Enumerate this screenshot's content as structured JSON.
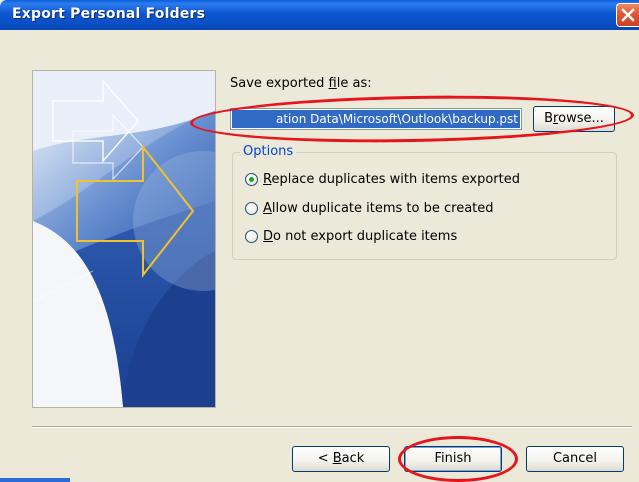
{
  "window": {
    "title": "Export Personal Folders",
    "accent": "#0a5fd8"
  },
  "save": {
    "label_prefix": "Save exported ",
    "label_underlined": "f",
    "label_suffix": "ile as:",
    "path_value": "ation Data\\Microsoft\\Outlook\\backup.pst",
    "browse_prefix": "B",
    "browse_underlined": "r",
    "browse_suffix": "owse..."
  },
  "options": {
    "legend": "Options",
    "items": [
      {
        "underlined": "R",
        "rest": "eplace duplicates with items exported",
        "selected": true
      },
      {
        "underlined": "A",
        "rest": "llow duplicate items to be created",
        "selected": false
      },
      {
        "underlined": "D",
        "rest": "o not export duplicate items",
        "selected": false
      }
    ]
  },
  "footer": {
    "back_prefix": "< ",
    "back_underlined": "B",
    "back_suffix": "ack",
    "finish_label": "Finish",
    "cancel_label": "Cancel"
  },
  "annotation_color": "#e8131b"
}
